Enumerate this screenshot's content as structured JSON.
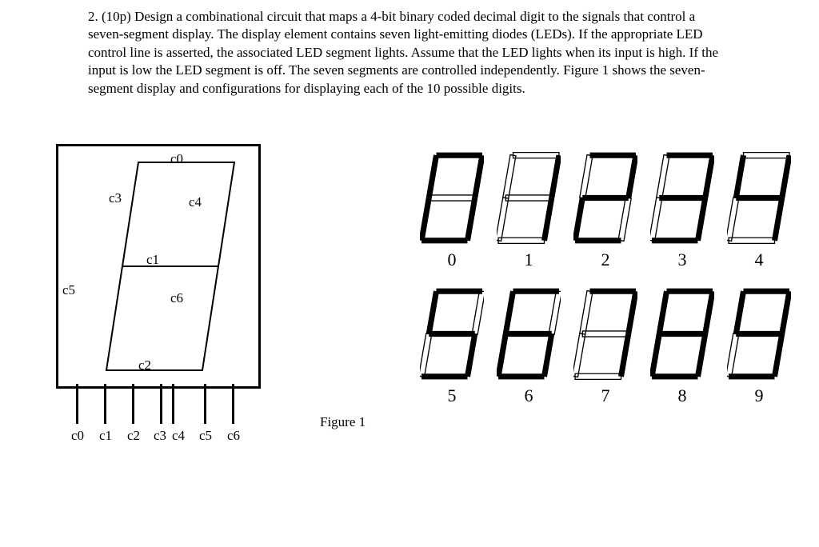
{
  "problem": {
    "number": "2.",
    "points": "(10p)",
    "text": "Design a combinational circuit that maps a 4-bit binary coded decimal digit to the signals that control a seven-segment display. The display element contains seven light-emitting diodes (LEDs). If the appropriate LED control line is asserted, the associated LED segment lights. Assume that the LED lights when its input is high. If the input is low the LED segment is off. The seven segments are controlled independently. Figure 1 shows the seven-segment display and configurations for displaying each of the 10 possible digits."
  },
  "segments": {
    "c0": "c0",
    "c1": "c1",
    "c2": "c2",
    "c3": "c3",
    "c4": "c4",
    "c5": "c5",
    "c6": "c6"
  },
  "pin_labels": [
    "c0",
    "c1",
    "c2",
    "c3",
    "c4",
    "c5",
    "c6"
  ],
  "figure_caption": "Figure 1",
  "digits": [
    {
      "label": "0",
      "on": [
        1,
        0,
        1,
        1,
        1,
        1,
        1
      ]
    },
    {
      "label": "1",
      "on": [
        0,
        0,
        0,
        0,
        1,
        0,
        1
      ]
    },
    {
      "label": "2",
      "on": [
        1,
        1,
        1,
        0,
        1,
        1,
        0
      ]
    },
    {
      "label": "3",
      "on": [
        1,
        1,
        1,
        0,
        1,
        0,
        1
      ]
    },
    {
      "label": "4",
      "on": [
        0,
        1,
        0,
        1,
        1,
        0,
        1
      ]
    },
    {
      "label": "5",
      "on": [
        1,
        1,
        1,
        1,
        0,
        0,
        1
      ]
    },
    {
      "label": "6",
      "on": [
        1,
        1,
        1,
        1,
        0,
        1,
        1
      ]
    },
    {
      "label": "7",
      "on": [
        1,
        0,
        0,
        0,
        1,
        0,
        1
      ]
    },
    {
      "label": "8",
      "on": [
        1,
        1,
        1,
        1,
        1,
        1,
        1
      ]
    },
    {
      "label": "9",
      "on": [
        1,
        1,
        1,
        1,
        1,
        0,
        1
      ]
    }
  ]
}
